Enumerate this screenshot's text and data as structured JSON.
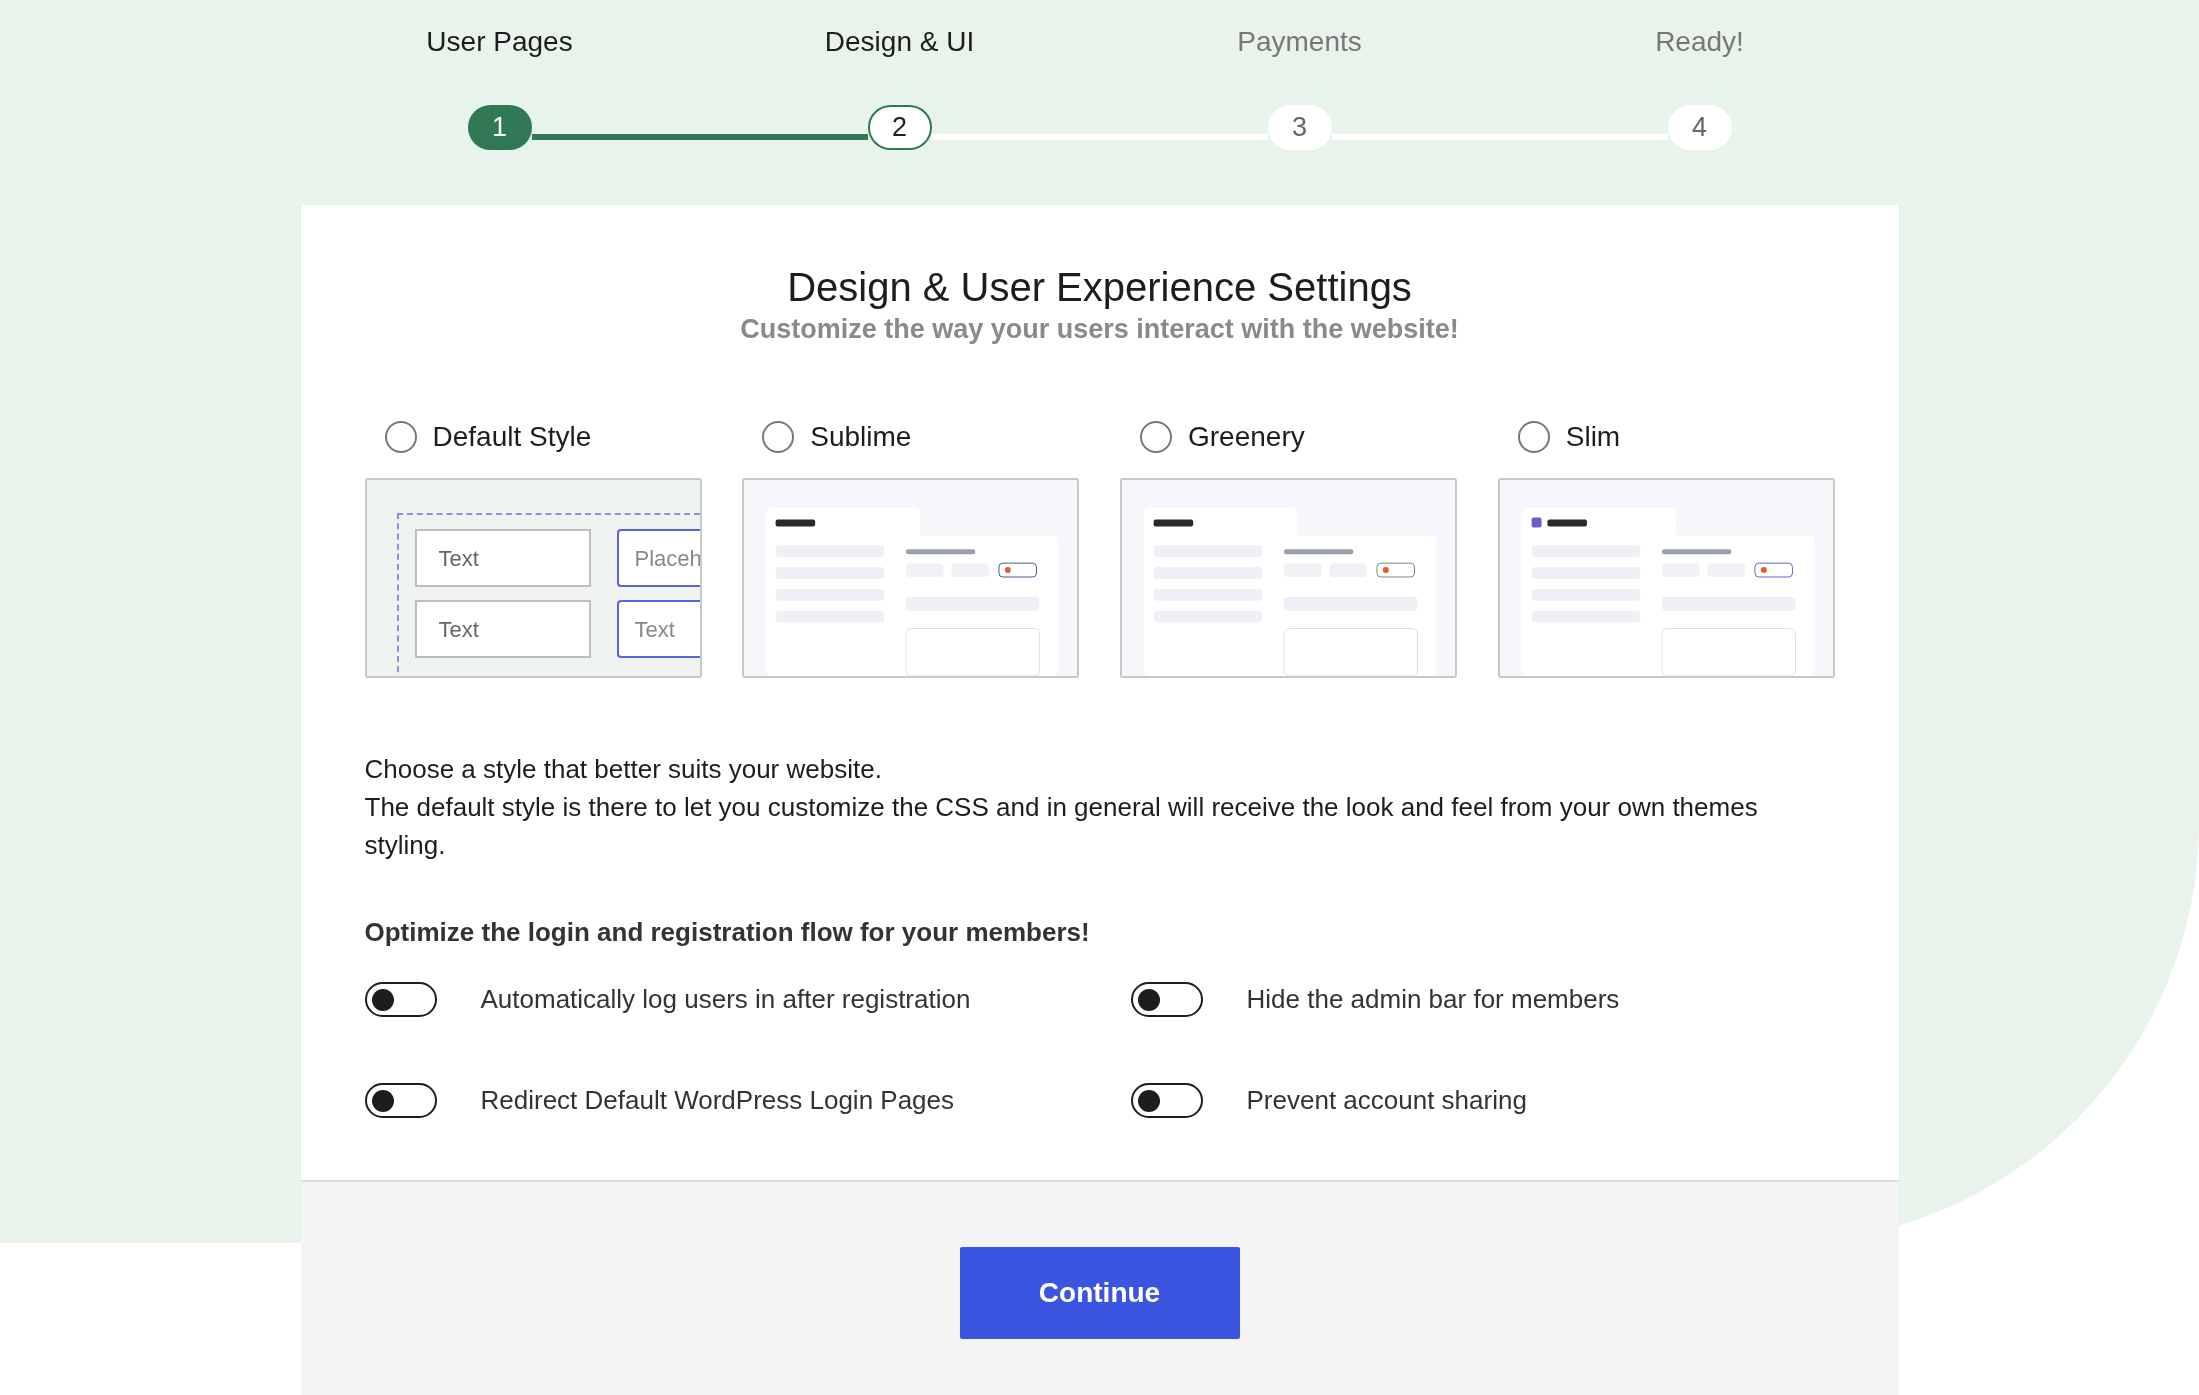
{
  "stepper": [
    {
      "label": "User Pages",
      "number": "1",
      "kind": "done"
    },
    {
      "label": "Design & UI",
      "number": "2",
      "kind": "current"
    },
    {
      "label": "Payments",
      "number": "3",
      "kind": "upcoming"
    },
    {
      "label": "Ready!",
      "number": "4",
      "kind": "upcoming"
    }
  ],
  "card": {
    "title": "Design & User Experience Settings",
    "subtitle": "Customize the way your users interact with the website!"
  },
  "styles": [
    {
      "label": "Default Style",
      "selected": false,
      "preview": {
        "kind": "fields",
        "texts": [
          "Text",
          "Placeh",
          "Text",
          "Text"
        ]
      }
    },
    {
      "label": "Sublime",
      "selected": false
    },
    {
      "label": "Greenery",
      "selected": false
    },
    {
      "label": "Slim",
      "selected": false
    }
  ],
  "description": [
    "Choose a style that better suits your website.",
    "The default style is there to let you customize the CSS and in general will receive the look and feel from your own themes styling."
  ],
  "options_heading": "Optimize the login and registration flow for your members!",
  "toggles": [
    {
      "label": "Automatically log users in after registration",
      "on": false
    },
    {
      "label": "Hide the admin bar for members",
      "on": false
    },
    {
      "label": "Redirect Default WordPress Login Pages",
      "on": false
    },
    {
      "label": "Prevent account sharing",
      "on": false
    }
  ],
  "continue_button": "Continue"
}
